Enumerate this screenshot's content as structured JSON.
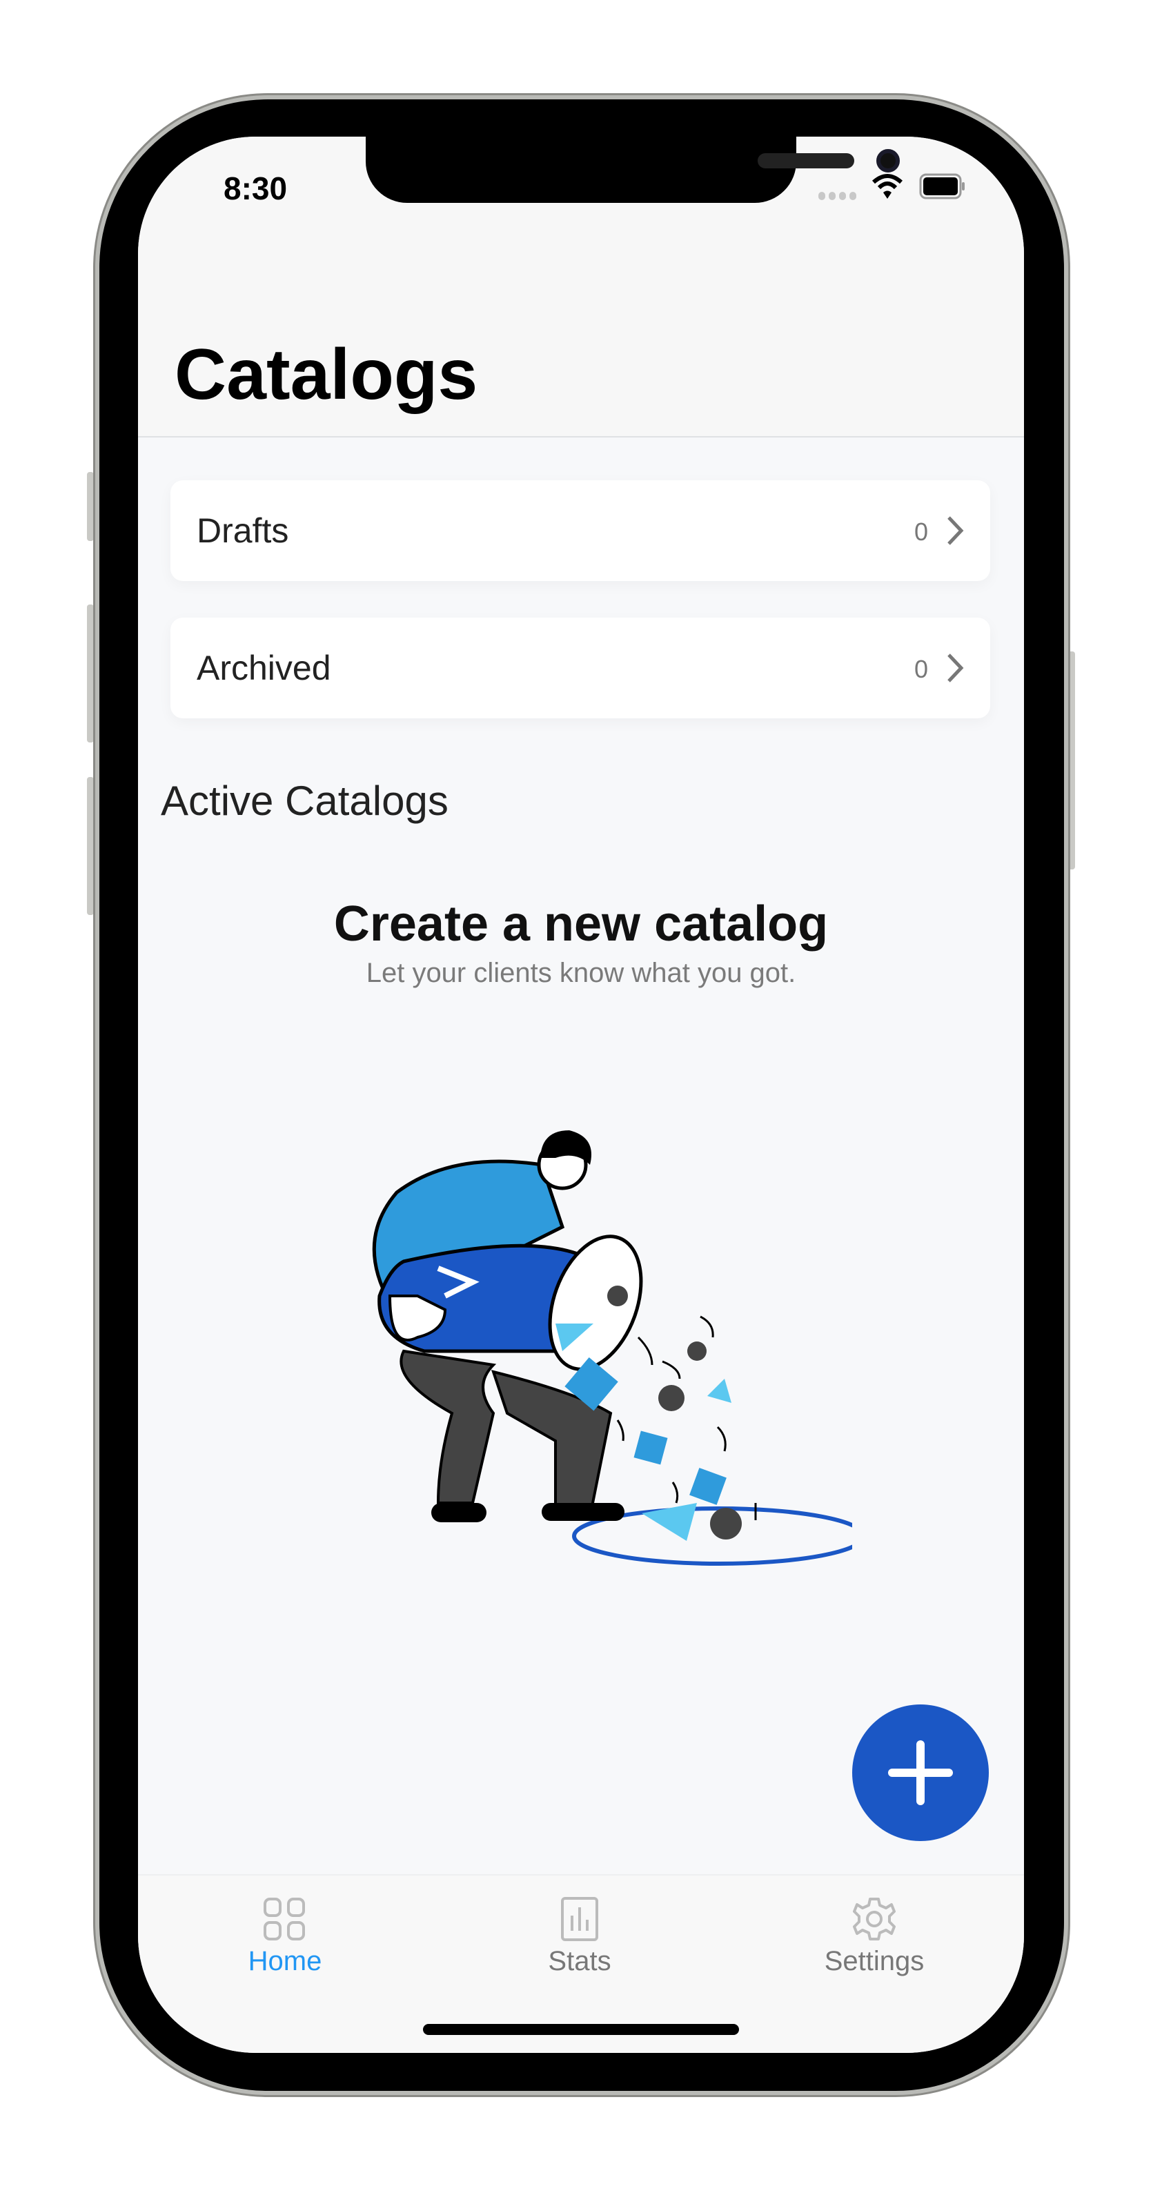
{
  "status_bar": {
    "time": "8:30",
    "wifi_icon": "wifi-icon",
    "battery_icon": "battery-icon"
  },
  "header": {
    "title": "Catalogs"
  },
  "lists": [
    {
      "label": "Drafts",
      "count": "0"
    },
    {
      "label": "Archived",
      "count": "0"
    }
  ],
  "active_section": {
    "title": "Active Catalogs"
  },
  "empty_state": {
    "title": "Create a new catalog",
    "subtitle": "Let your clients know what you got."
  },
  "fab": {
    "icon": "plus-icon",
    "color": "#1b57c5"
  },
  "tabbar": {
    "items": [
      {
        "label": "Home",
        "icon": "grid-icon",
        "active": true
      },
      {
        "label": "Stats",
        "icon": "bar-chart-icon",
        "active": false
      },
      {
        "label": "Settings",
        "icon": "gear-icon",
        "active": false
      }
    ],
    "active_color": "#2196f3"
  }
}
